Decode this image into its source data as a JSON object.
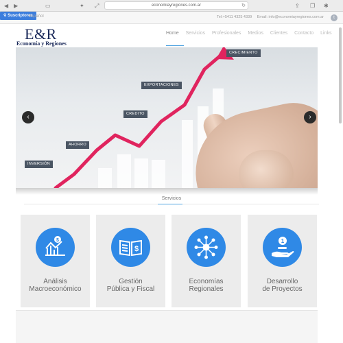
{
  "browser": {
    "url": "economiayregiones.com.ar"
  },
  "topbar": {
    "subscribers_button": "Suscriptores",
    "language": "Español",
    "phone": "Tel:+5411 4325 4339",
    "email": "Email: info@economiayregiones.com.ar"
  },
  "header": {
    "logo_main": "E&R",
    "logo_sub": "Economía y Regiones",
    "nav": [
      "Home",
      "Servicios",
      "Profesionales",
      "Medios",
      "Clientes",
      "Contacto",
      "Links"
    ]
  },
  "hero": {
    "labels": {
      "crecimiento": "CRECIMIENTO",
      "exportaciones": "EXPORTACIONES",
      "credito": "CREDITO",
      "ahorro": "AHORRO",
      "inversion": "INVERSIÓN"
    },
    "prev": "‹",
    "next": "›"
  },
  "services": {
    "title": "Servicios",
    "cards": [
      {
        "label": "Análisis\nMacroeconómico",
        "icon": "chart-analysis-icon"
      },
      {
        "label": "Gestión\nPública y Fiscal",
        "icon": "book-dollar-icon"
      },
      {
        "label": "Economías\nRegionales",
        "icon": "network-icon"
      },
      {
        "label": "Desarrollo\nde Proyectos",
        "icon": "hand-coins-icon"
      }
    ]
  },
  "colors": {
    "accent": "#2f89e6",
    "brand": "#1b2a5a",
    "arrow": "#e0245e"
  }
}
